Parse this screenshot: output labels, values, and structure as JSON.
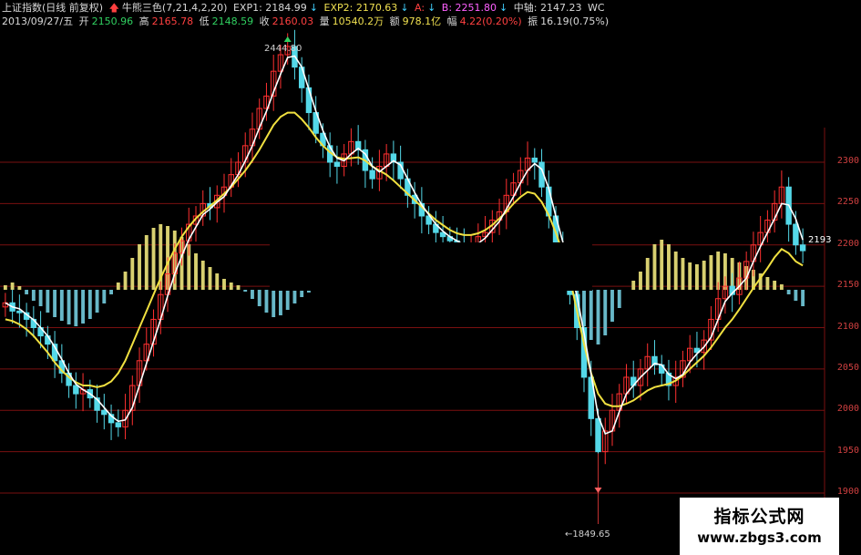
{
  "header": {
    "line1": {
      "index_name": "上证指数(日线 前复权)",
      "indicator": "牛熊三色(7,21,4,2,20)",
      "exp1": "EXP1: 2184.99",
      "exp2": "EXP2: 2170.63",
      "a": "A:",
      "b": "B: 2251.80",
      "mid": "中轴: 2147.23",
      "extra": "WC"
    },
    "line2": {
      "date": "2013/09/27/五",
      "open_label": "开",
      "open": "2150.96",
      "high_label": "高",
      "high": "2165.78",
      "low_label": "低",
      "low": "2148.59",
      "close_label": "收",
      "close": "2160.03",
      "vol_label": "量",
      "vol": "10540.2万",
      "amt_label": "额",
      "amt": "978.1亿",
      "chg_label": "幅",
      "chg": "4.22(0.20%)",
      "amp_label": "振",
      "amp": "16.19(0.75%)"
    }
  },
  "annotations": {
    "high_mark": "2444.80",
    "low_mark": "←1849.65",
    "last_price": "2193"
  },
  "watermark": {
    "title": "指标公式网",
    "url": "www.zbgs3.com"
  },
  "colors": {
    "background": "#000000",
    "up": "#ff3030",
    "down": "#54d8e8",
    "white_line": "#ffffff",
    "yellow_line": "#f0e040",
    "blue_line": "#2030c0",
    "grid": "#7a1010",
    "hist_pos": "#d8d070",
    "hist_neg": "#68b8c8"
  },
  "chart_data": {
    "type": "candlestick",
    "title": "",
    "y_ticks": [
      "2300",
      "2250",
      "2200",
      "2150",
      "2100",
      "2050",
      "2000",
      "1950",
      "1900"
    ],
    "ylim": [
      1890,
      2455
    ],
    "grid": true,
    "high": 2444.8,
    "low": 1849.65,
    "closes": [
      2130,
      2120,
      2118,
      2110,
      2100,
      2090,
      2080,
      2060,
      2045,
      2030,
      2020,
      2025,
      2015,
      2000,
      1995,
      1985,
      1980,
      2000,
      2030,
      2060,
      2080,
      2110,
      2140,
      2165,
      2190,
      2205,
      2225,
      2235,
      2250,
      2245,
      2260,
      2270,
      2285,
      2300,
      2320,
      2340,
      2365,
      2380,
      2410,
      2430,
      2440,
      2415,
      2390,
      2360,
      2335,
      2320,
      2300,
      2295,
      2310,
      2325,
      2315,
      2290,
      2280,
      2295,
      2310,
      2300,
      2280,
      2260,
      2250,
      2235,
      2225,
      2215,
      2210,
      2205,
      2200,
      2195,
      2200,
      2210,
      2215,
      2230,
      2240,
      2260,
      2275,
      2290,
      2305,
      2300,
      2270,
      2235,
      2200,
      2175,
      2140,
      2100,
      2040,
      1990,
      1950,
      1975,
      2000,
      2020,
      2040,
      2030,
      2050,
      2065,
      2055,
      2045,
      2030,
      2040,
      2060,
      2075,
      2070,
      2085,
      2110,
      2135,
      2150,
      2140,
      2160,
      2180,
      2200,
      2215,
      2230,
      2250,
      2270,
      2225,
      2200,
      2193
    ],
    "yellow_line": [
      2110,
      2108,
      2104,
      2098,
      2090,
      2080,
      2070,
      2058,
      2048,
      2040,
      2034,
      2030,
      2030,
      2028,
      2030,
      2035,
      2045,
      2060,
      2080,
      2100,
      2120,
      2140,
      2160,
      2178,
      2195,
      2210,
      2222,
      2232,
      2240,
      2247,
      2254,
      2262,
      2270,
      2280,
      2290,
      2302,
      2315,
      2330,
      2345,
      2355,
      2360,
      2360,
      2352,
      2342,
      2330,
      2320,
      2312,
      2306,
      2304,
      2305,
      2306,
      2302,
      2295,
      2290,
      2285,
      2278,
      2270,
      2262,
      2254,
      2246,
      2238,
      2230,
      2224,
      2218,
      2214,
      2212,
      2212,
      2214,
      2218,
      2224,
      2232,
      2240,
      2250,
      2258,
      2264,
      2262,
      2252,
      2236,
      2215,
      2190,
      2160,
      2120,
      2080,
      2045,
      2020,
      2008,
      2005,
      2005,
      2008,
      2012,
      2018,
      2024,
      2028,
      2030,
      2032,
      2036,
      2042,
      2050,
      2058,
      2066,
      2076,
      2088,
      2100,
      2110,
      2122,
      2135,
      2148,
      2160,
      2172,
      2185,
      2195,
      2190,
      2180,
      2175
    ],
    "histogram": [
      5,
      8,
      4,
      -5,
      -12,
      -18,
      -25,
      -30,
      -34,
      -38,
      -40,
      -37,
      -32,
      -25,
      -15,
      -5,
      8,
      20,
      35,
      50,
      60,
      68,
      72,
      70,
      65,
      58,
      50,
      40,
      32,
      25,
      18,
      12,
      8,
      5,
      -2,
      -10,
      -18,
      -25,
      -30,
      -28,
      -22,
      -15,
      -8,
      -3,
      0,
      0,
      0,
      0,
      0,
      0,
      0,
      0,
      0,
      0,
      0,
      0,
      0,
      0,
      0,
      0,
      0,
      0,
      0,
      0,
      0,
      0,
      0,
      0,
      0,
      0,
      0,
      0,
      0,
      0,
      0,
      0,
      0,
      0,
      0,
      0,
      0,
      -20,
      -40,
      -55,
      -60,
      -50,
      -35,
      -20,
      0,
      10,
      20,
      35,
      50,
      55,
      50,
      42,
      35,
      30,
      28,
      32,
      38,
      42,
      40,
      35,
      30,
      26,
      22,
      18,
      14,
      10,
      6,
      -5,
      -12,
      -18
    ]
  }
}
